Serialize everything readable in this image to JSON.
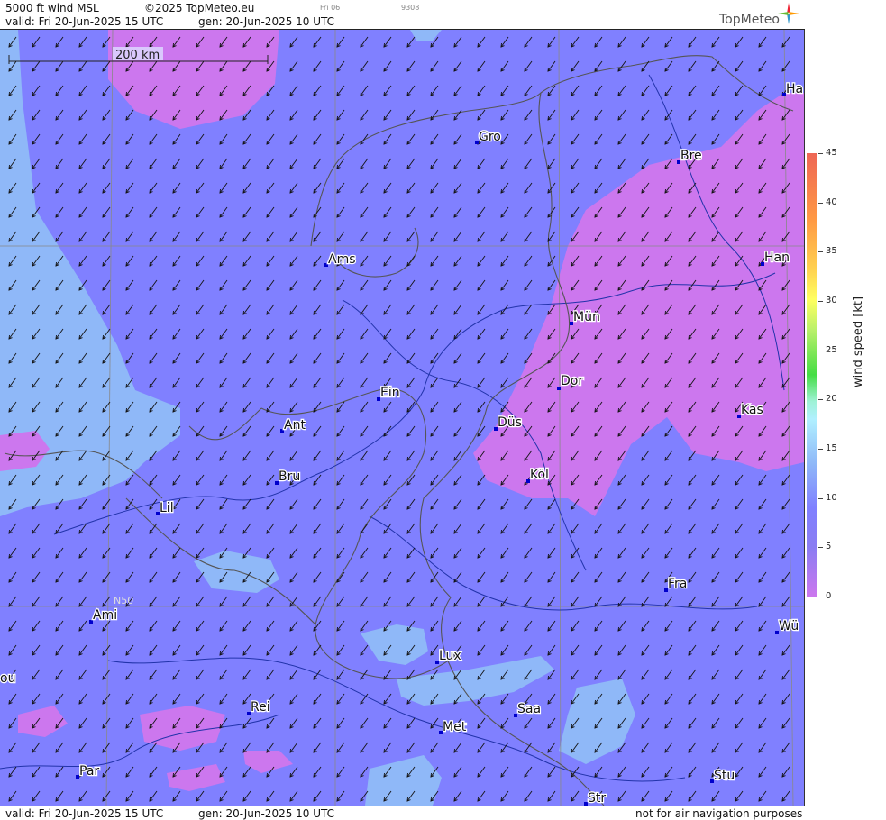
{
  "header": {
    "title": "5000 ft wind MSL",
    "copyright": "©2025 TopMeteo.eu",
    "small_day": "Fri 06",
    "small_code": "9308",
    "valid": "valid:  Fri   20-Jun-2025   15 UTC",
    "gen": "gen:  20-Jun-2025  10 UTC",
    "logo": "TopMeteo"
  },
  "map": {
    "scale_label": "200 km",
    "latitude_label": "N50",
    "cities": [
      {
        "label": "Gro"
      },
      {
        "label": "Bre"
      },
      {
        "label": "Ha"
      },
      {
        "label": "Ams"
      },
      {
        "label": "Han"
      },
      {
        "label": "Mün"
      },
      {
        "label": "Ein"
      },
      {
        "label": "Dor"
      },
      {
        "label": "Kas"
      },
      {
        "label": "Ant"
      },
      {
        "label": "Düs"
      },
      {
        "label": "Köl"
      },
      {
        "label": "Bru"
      },
      {
        "label": "Lil"
      },
      {
        "label": "Fra"
      },
      {
        "label": "Ami"
      },
      {
        "label": "Wü"
      },
      {
        "label": "ou"
      },
      {
        "label": "Lux"
      },
      {
        "label": "Rei"
      },
      {
        "label": "Saa"
      },
      {
        "label": "Met"
      },
      {
        "label": "Par"
      },
      {
        "label": "Stu"
      },
      {
        "label": "Str"
      }
    ],
    "colors": {
      "speed_0_5": "#cc77ee",
      "speed_5_10": "#8080ff",
      "speed_10_15": "#8fb8f8",
      "border": "#555555",
      "river": "#2233aa",
      "city": "#0000cc"
    }
  },
  "legend": {
    "unit": "wind  speed  [kt]",
    "ticks": [
      "45",
      "40",
      "35",
      "30",
      "25",
      "20",
      "15",
      "10",
      "5",
      "0"
    ]
  },
  "footer": {
    "valid": "valid:  Fri   20-Jun-2025   15 UTC",
    "gen": "gen:  20-Jun-2025  10 UTC",
    "note": "not for air navigation purposes"
  }
}
